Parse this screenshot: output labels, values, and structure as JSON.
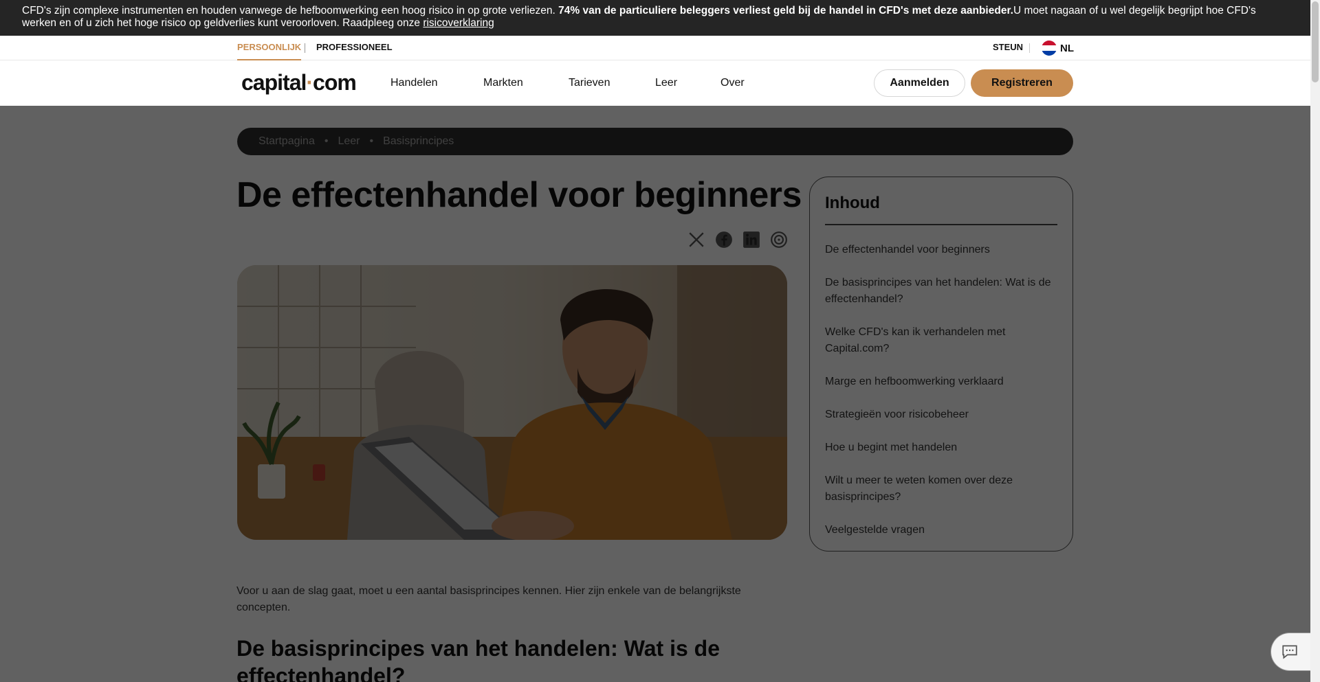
{
  "risk_banner": {
    "text_before": "CFD's zijn complexe instrumenten en houden vanwege de hefboomwerking een hoog risico in op grote verliezen. ",
    "text_bold": "74% van de particuliere beleggers verliest geld bij de handel in CFD's met deze aanbieder.",
    "text_after": "U moet nagaan of u wel degelijk begrijpt hoe CFD's werken en of u zich het hoge risico op geldverlies kunt veroorloven. Raadpleeg onze ",
    "link": "risicoverklaring"
  },
  "topbar": {
    "personal": "PERSOONLIJK",
    "professional": "PROFESSIONEEL",
    "support": "STEUN",
    "language": "NL"
  },
  "nav": {
    "logo_left": "capital",
    "logo_dot": "·",
    "logo_right": "com",
    "links": [
      "Handelen",
      "Markten",
      "Tarieven",
      "Leer",
      "Over"
    ],
    "login": "Aanmelden",
    "register": "Registreren"
  },
  "breadcrumb": [
    "Startpagina",
    "Leer",
    "Basisprincipes"
  ],
  "breadcrumb_sep": "•",
  "article": {
    "title": "De effectenhandel voor beginners",
    "intro": "Voor u aan de slag gaat, moet u een aantal basisprincipes kennen. Hier zijn enkele van de belangrijkste concepten.",
    "h2": "De basisprincipes van het handelen: Wat is de effectenhandel?"
  },
  "share_icons": [
    "x-icon",
    "facebook-icon",
    "linkedin-icon",
    "copy-link-icon"
  ],
  "toc": {
    "title": "Inhoud",
    "items": [
      "De effectenhandel voor beginners",
      "De basisprincipes van het handelen: Wat is de effectenhandel?",
      "Welke CFD's kan ik verhandelen met Capital.com?",
      "Marge en hefboomwerking verklaard",
      "Strategieën voor risicobeheer",
      "Hoe u begint met handelen",
      "Wilt u meer te weten komen over deze basisprincipes?",
      "Veelgestelde vragen"
    ]
  },
  "colors": {
    "accent": "#c98d51",
    "banner_bg": "#252525",
    "overlay": "rgba(0,0,0,0.62)"
  }
}
